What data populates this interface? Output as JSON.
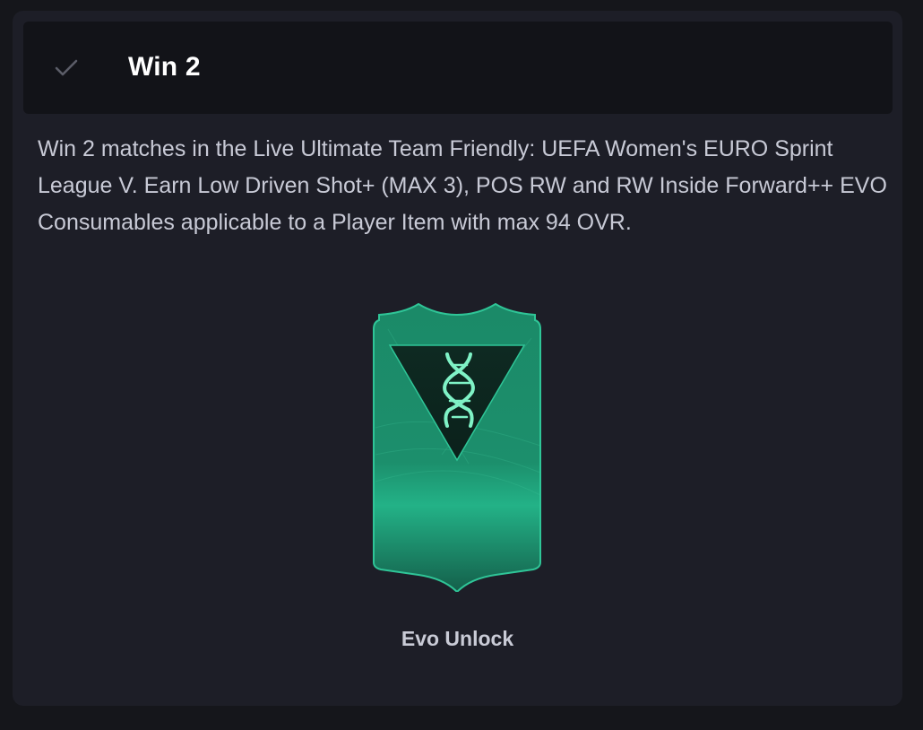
{
  "objective": {
    "title": "Win 2",
    "completed_icon": "check-icon",
    "description": "Win 2 matches in the Live Ultimate Team Friendly: UEFA Women's EURO Sprint League V. Earn Low Driven Shot+ (MAX 3), POS RW and RW Inside Forward++ EVO Consumables applicable to a Player Item with max 94 OVR."
  },
  "reward": {
    "label": "Evo Unlock",
    "icon": "dna-icon",
    "card_color": "#1e9a73",
    "accent_color": "#7ff2c6"
  }
}
